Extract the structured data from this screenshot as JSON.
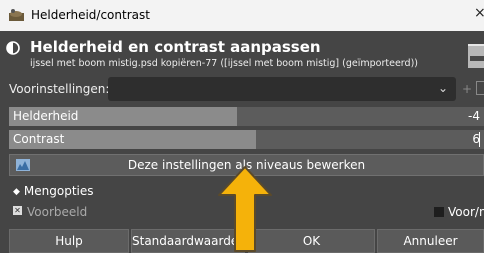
{
  "window": {
    "title": "Helderheid/contrast",
    "close_glyph": "×"
  },
  "header": {
    "title": "Helderheid en contrast aanpassen",
    "subtitle": "ijssel met boom mistig.psd kopiëren-77 ([ijssel met boom mistig] (geïmporteerd))"
  },
  "presets": {
    "label": "Voorinstellingen:",
    "value": "",
    "add_glyph": "+"
  },
  "brightness": {
    "label": "Helderheid",
    "value": "-4",
    "fill_fraction": 0.48
  },
  "contrast": {
    "label": "Contrast",
    "value": "6",
    "fill_fraction": 0.52
  },
  "levels_button": {
    "label": "Deze instellingen als niveaus bewerken"
  },
  "blend_options": {
    "label": "Mengopties"
  },
  "preview": {
    "label": "Voorbeeld",
    "checked": true
  },
  "split_view": {
    "label": "Voor/n"
  },
  "buttons": {
    "help": "Hulp",
    "reset": "Standaardwaarden",
    "ok": "OK",
    "cancel": "Annuleer"
  },
  "overlay": {
    "arrow_color": "#f5b20a"
  }
}
